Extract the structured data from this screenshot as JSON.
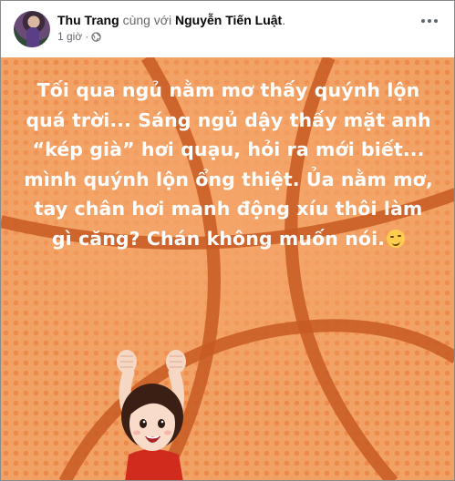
{
  "post": {
    "author": "Thu Trang",
    "with_text": "cùng với",
    "tagged": "Nguyễn Tiến Luật",
    "tagged_suffix": ".",
    "time": "1 giờ",
    "separator": "·",
    "privacy_icon": "globe-icon",
    "more_icon": "more-options-icon",
    "text_lines": [
      "Tối qua ngủ nằm mơ thấy quýnh lộn",
      "quá trời... Sáng ngủ dậy thấy mặt anh",
      "“kép già” hơi quạu, hỏi ra mới biết...",
      "mình quýnh lộn ổng thiệt. Ủa nằm mơ,",
      "tay chân hơi manh động xíu thôi làm",
      "gì căng? Chán không muốn nói."
    ],
    "emoji_icon": "smirk-emoji-icon",
    "background_colors": {
      "base": "#f2a164",
      "dots": "#e87636",
      "lines": "#c75a23"
    }
  }
}
